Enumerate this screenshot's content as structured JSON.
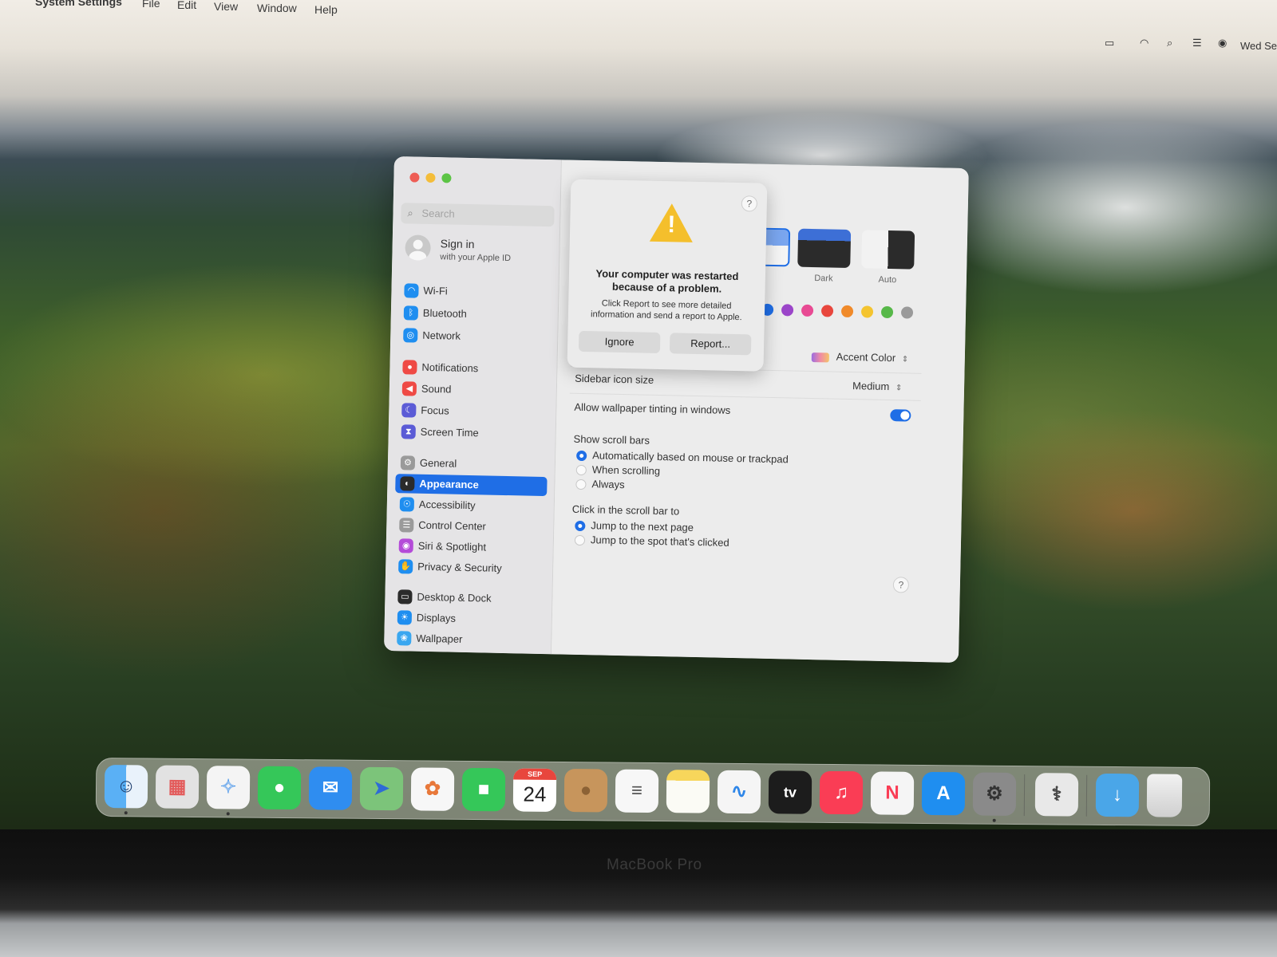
{
  "menubar": {
    "app_name": "System Settings",
    "menus": [
      "File",
      "Edit",
      "View",
      "Window",
      "Help"
    ],
    "clock": "Wed Se"
  },
  "settings": {
    "search_placeholder": "Search",
    "signin_title": "Sign in",
    "signin_subtitle": "with your Apple ID",
    "sidebar_items": [
      {
        "label": "Wi-Fi",
        "icon": "wifi-icon",
        "color": "#1f8ef0"
      },
      {
        "label": "Bluetooth",
        "icon": "bluetooth-icon",
        "color": "#1f8ef0"
      },
      {
        "label": "Network",
        "icon": "globe-icon",
        "color": "#1f8ef0"
      },
      {
        "label": "Notifications",
        "icon": "bell-icon",
        "color": "#ef4a45"
      },
      {
        "label": "Sound",
        "icon": "speaker-icon",
        "color": "#ef4a45"
      },
      {
        "label": "Focus",
        "icon": "moon-icon",
        "color": "#5b5bd6"
      },
      {
        "label": "Screen Time",
        "icon": "hourglass-icon",
        "color": "#5b5bd6"
      },
      {
        "label": "General",
        "icon": "gear-icon",
        "color": "#9a9a9a"
      },
      {
        "label": "Appearance",
        "icon": "appearance-icon",
        "color": "#2b2b2b"
      },
      {
        "label": "Accessibility",
        "icon": "accessibility-icon",
        "color": "#1f8ef0"
      },
      {
        "label": "Control Center",
        "icon": "control-center-icon",
        "color": "#9a9a9a"
      },
      {
        "label": "Siri & Spotlight",
        "icon": "siri-icon",
        "color": "#b44bd8"
      },
      {
        "label": "Privacy & Security",
        "icon": "hand-icon",
        "color": "#1f8ef0"
      },
      {
        "label": "Desktop & Dock",
        "icon": "dock-icon",
        "color": "#2b2b2b"
      },
      {
        "label": "Displays",
        "icon": "sun-icon",
        "color": "#1f8ef0"
      },
      {
        "label": "Wallpaper",
        "icon": "wallpaper-icon",
        "color": "#3aa7f0"
      }
    ],
    "selected_item": "Appearance",
    "appearance": {
      "partial_light_label": "ht",
      "dark_label": "Dark",
      "auto_label": "Auto",
      "accent_partial_label": "r",
      "accent_colors": [
        "#1f6ee6",
        "#9b45c9",
        "#e84a93",
        "#e8463d",
        "#f08a2a",
        "#f4c430",
        "#57b849",
        "#9a9a9a"
      ],
      "highlight_value": "Accent Color",
      "sidebar_icon_size_label": "Sidebar icon size",
      "sidebar_icon_size_value": "Medium",
      "wallpaper_tinting_label": "Allow wallpaper tinting in windows",
      "wallpaper_tinting_on": true,
      "scroll_bars_label": "Show scroll bars",
      "scroll_bar_options": [
        "Automatically based on mouse or trackpad",
        "When scrolling",
        "Always"
      ],
      "scroll_bar_selected": "Automatically based on mouse or trackpad",
      "click_scroll_label": "Click in the scroll bar to",
      "click_scroll_options": [
        "Jump to the next page",
        "Jump to the spot that's clicked"
      ],
      "click_scroll_selected": "Jump to the next page"
    }
  },
  "alert": {
    "title": "Your computer was restarted because of a problem.",
    "message": "Click Report to see more detailed information and send a report to Apple.",
    "ignore_label": "Ignore",
    "report_label": "Report...",
    "help_glyph": "?"
  },
  "dock": {
    "apps": [
      {
        "name": "finder-icon",
        "color": "#3d8ff0",
        "glyph": "☺"
      },
      {
        "name": "launchpad-icon",
        "color": "#dcdcdc",
        "glyph": "▦"
      },
      {
        "name": "safari-icon",
        "color": "#2e86e8",
        "glyph": "✧"
      },
      {
        "name": "messages-icon",
        "color": "#35c759",
        "glyph": "◯"
      },
      {
        "name": "mail-icon",
        "color": "#2f8df0",
        "glyph": "✉"
      },
      {
        "name": "maps-icon",
        "color": "#6dbb6a",
        "glyph": "➤"
      },
      {
        "name": "photos-icon",
        "color": "#f2f2f2",
        "glyph": "✿"
      },
      {
        "name": "facetime-icon",
        "color": "#35c759",
        "glyph": "■"
      },
      {
        "name": "calendar-icon",
        "color": "#ffffff",
        "glyph": ""
      },
      {
        "name": "contacts-icon",
        "color": "#c7955c",
        "glyph": "●"
      },
      {
        "name": "reminders-icon",
        "color": "#f7f7f7",
        "glyph": "≡"
      },
      {
        "name": "notes-icon",
        "color": "#f7d65b",
        "glyph": ""
      },
      {
        "name": "freeform-icon",
        "color": "#f5f5f5",
        "glyph": "∿"
      },
      {
        "name": "apple-tv-icon",
        "color": "#1c1c1c",
        "glyph": "tv"
      },
      {
        "name": "music-icon",
        "color": "#fa3d55",
        "glyph": "♫"
      },
      {
        "name": "news-icon",
        "color": "#f5f5f5",
        "glyph": "N"
      },
      {
        "name": "app-store-icon",
        "color": "#1f8ef0",
        "glyph": "A"
      },
      {
        "name": "system-settings-icon",
        "color": "#8a8a8a",
        "glyph": "⚙"
      },
      {
        "name": "disk-utility-icon",
        "color": "#e8e8e8",
        "glyph": "⚕"
      },
      {
        "name": "downloads-folder-icon",
        "color": "#4aa6e8",
        "glyph": "↓"
      },
      {
        "name": "trash-icon",
        "color": "#e6e6e6",
        "glyph": ""
      }
    ],
    "calendar_month": "SEP",
    "calendar_day": "24"
  },
  "hardware": {
    "bezel_label": "MacBook Pro"
  }
}
